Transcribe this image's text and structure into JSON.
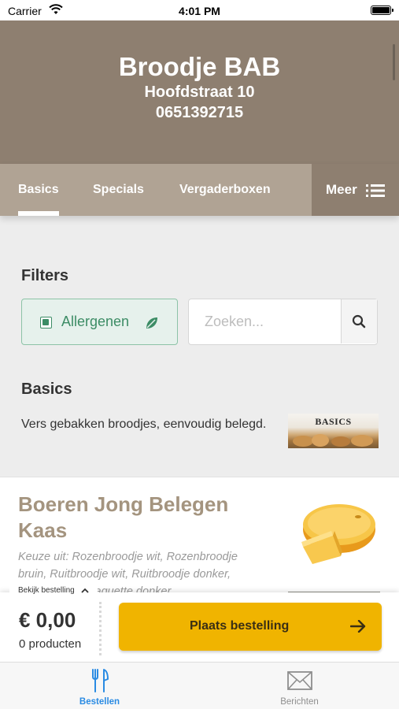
{
  "status_bar": {
    "carrier": "Carrier",
    "time": "4:01 PM"
  },
  "header": {
    "name": "Broodje BAB",
    "address": "Hoofdstraat 10",
    "phone": "0651392715"
  },
  "tabs": [
    {
      "label": "Basics",
      "active": true
    },
    {
      "label": "Specials",
      "active": false
    },
    {
      "label": "Vergaderboxen",
      "active": false
    }
  ],
  "more_tab": {
    "label": "Meer",
    "icon": "list-menu-icon"
  },
  "filters": {
    "title": "Filters",
    "allergens_label": "Allergenen",
    "search_placeholder": "Zoeken...",
    "search_value": ""
  },
  "section": {
    "title": "Basics",
    "description": "Vers gebakken broodjes, eenvoudig belegd.",
    "image_label": "BASICS"
  },
  "product": {
    "name": "Boeren Jong Belegen Kaas",
    "description": "Keuze uit: Rozenbroodje wit, Rozenbroodje bruin, Ruitbroodje wit, Ruitbroodje donker, Baguette wit, Baguette donker"
  },
  "order_bar": {
    "view_order_label": "Bekijk bestelling",
    "price": "€ 0,00",
    "count": "0 producten",
    "place_order_label": "Plaats bestelling"
  },
  "tabbar": [
    {
      "label": "Bestellen",
      "icon": "fork-knife-icon",
      "active": true
    },
    {
      "label": "Berichten",
      "icon": "envelope-icon",
      "active": false
    }
  ],
  "colors": {
    "brand": "#8e7f70",
    "tab_bg": "#b0a394",
    "accent": "#f0b400",
    "allergen_green": "#3c8c65",
    "active_blue": "#2a8be3",
    "product_title": "#a4947f"
  }
}
